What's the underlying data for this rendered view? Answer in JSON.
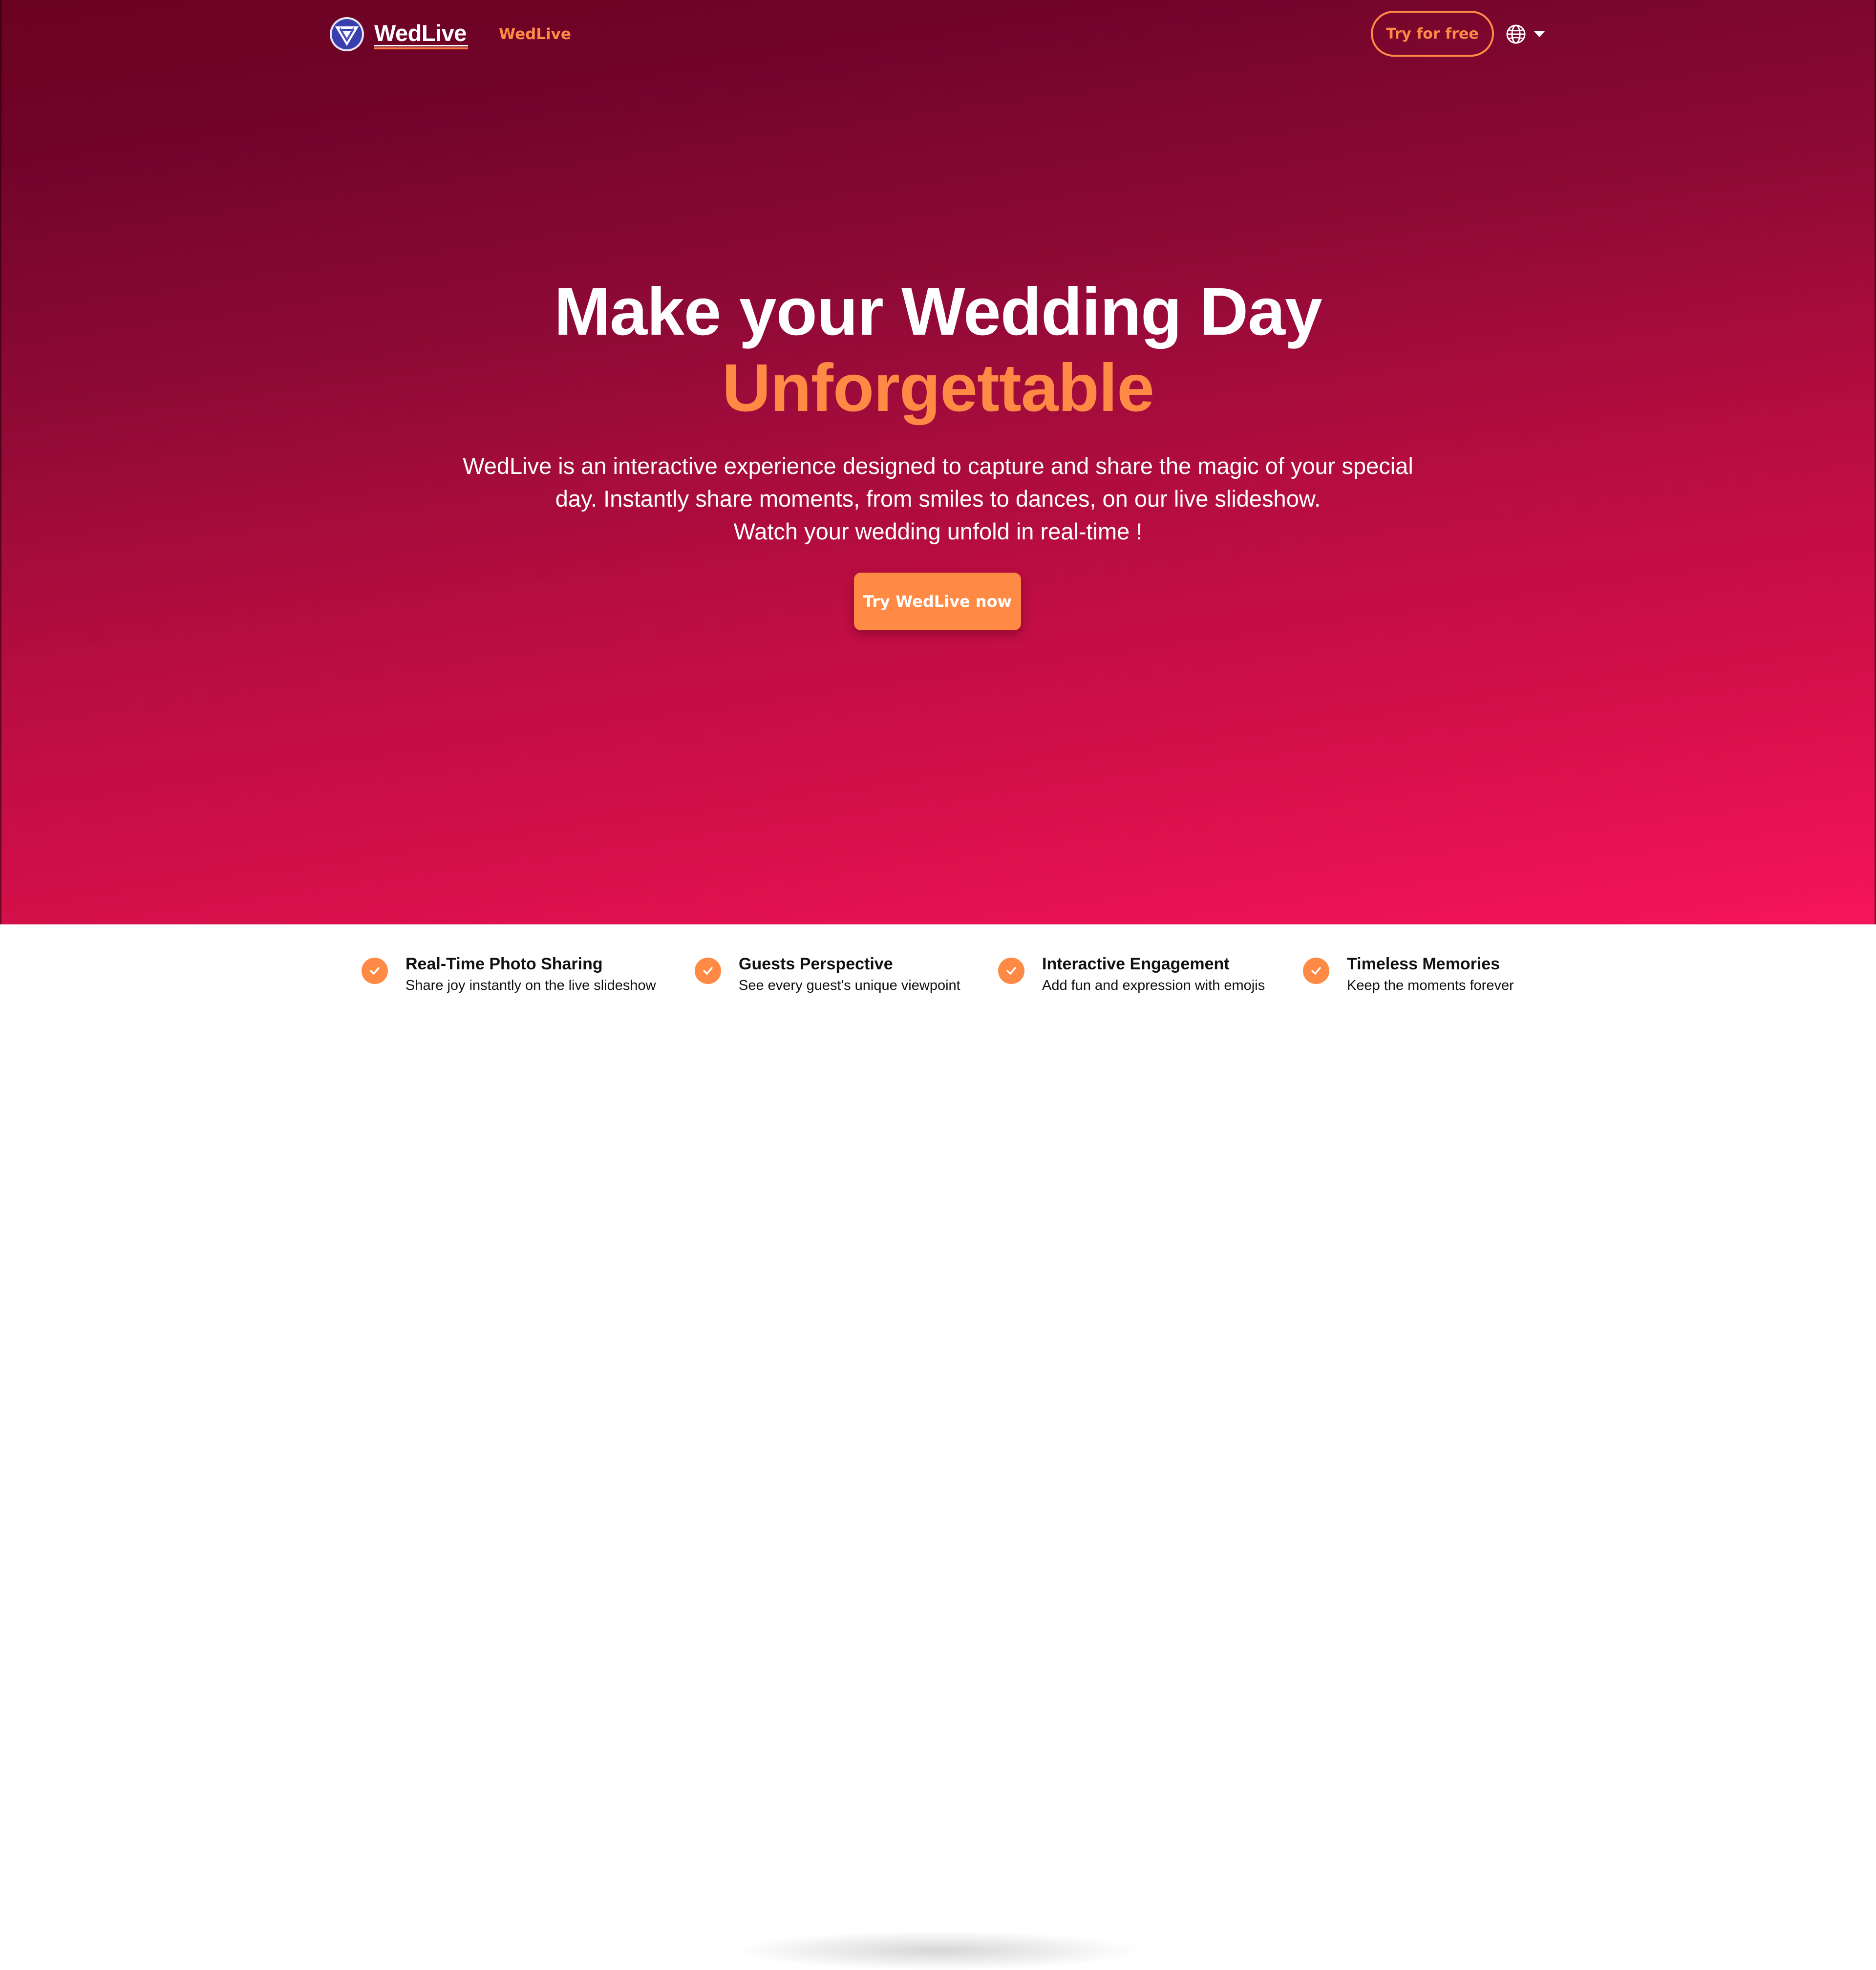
{
  "nav": {
    "brand": "WedLive",
    "link": "WedLive",
    "try_free": "Try for free",
    "language_icon": "globe-icon"
  },
  "hero": {
    "headline": "Make your Wedding Day",
    "headline_accent": "Unforgettable",
    "description_lines": [
      "WedLive is an interactive experience designed to capture and share the magic of your special",
      "day. Instantly share moments, from smiles to dances, on our live slideshow.",
      "Watch your wedding unfold in real-time !"
    ],
    "cta": "Try WedLive now"
  },
  "features": [
    {
      "title": "Real-Time Photo Sharing",
      "subtitle": "Share joy instantly on the live slideshow",
      "icon": "check-icon"
    },
    {
      "title": "Guests Perspective",
      "subtitle": "See every guest's unique viewpoint",
      "icon": "check-icon"
    },
    {
      "title": "Interactive Engagement",
      "subtitle": "Add fun and expression with emojis",
      "icon": "check-icon"
    },
    {
      "title": "Timeless Memories",
      "subtitle": "Keep the moments forever",
      "icon": "check-icon"
    }
  ],
  "colors": {
    "accent": "#ff8a45",
    "hero_top": "#6a0222",
    "hero_bottom": "#f7145a",
    "logo_blue": "#3a3fb0"
  }
}
